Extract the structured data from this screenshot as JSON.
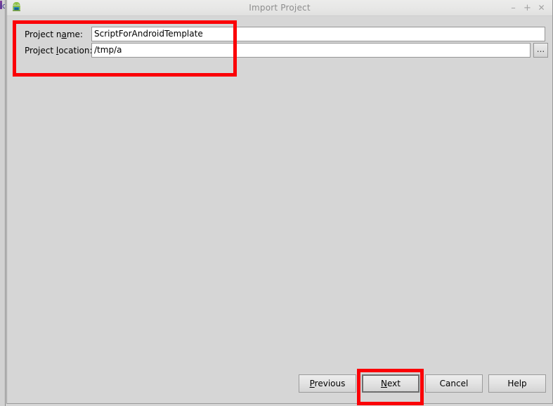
{
  "window": {
    "title": "Import Project",
    "icon": "android-robot-icon",
    "controls": {
      "minimize": "–",
      "maximize": "+",
      "close": "✕"
    }
  },
  "background_window": {
    "title_fragment": "id"
  },
  "form": {
    "rows": [
      {
        "label_before": "Project n",
        "mnemonic": "a",
        "label_after": "me:",
        "value": "ScriptForAndroidTemplate",
        "placeholder": ""
      },
      {
        "label_before": "Project ",
        "mnemonic": "l",
        "label_after": "ocation:",
        "value": "/tmp/a",
        "placeholder": ""
      }
    ],
    "browse_label": "..."
  },
  "buttons": [
    {
      "before": "",
      "mnemonic": "P",
      "after": "revious",
      "default": false
    },
    {
      "before": "",
      "mnemonic": "N",
      "after": "ext",
      "default": true
    },
    {
      "before": "Cancel",
      "mnemonic": "",
      "after": "",
      "default": false
    },
    {
      "before": "Help",
      "mnemonic": "",
      "after": "",
      "default": false
    }
  ],
  "annotations": {
    "color": "#fb0007",
    "regions": [
      {
        "name": "project-fields-highlight"
      },
      {
        "name": "next-button-highlight"
      }
    ]
  }
}
